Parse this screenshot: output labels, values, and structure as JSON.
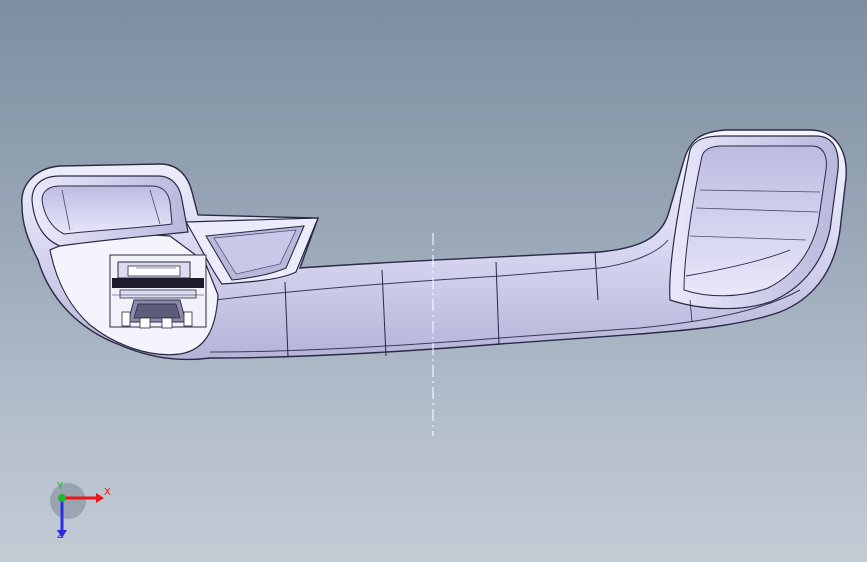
{
  "viewport": {
    "model": "grab-handle-part",
    "background_top": "#7e8ea1",
    "background_bottom": "#c3cbd5"
  },
  "triad": {
    "x_label": "X",
    "y_label": "Y",
    "z_label": "Z",
    "x_color": "#e8161b",
    "y_color": "#1fb430",
    "z_color": "#2a2ee0"
  }
}
